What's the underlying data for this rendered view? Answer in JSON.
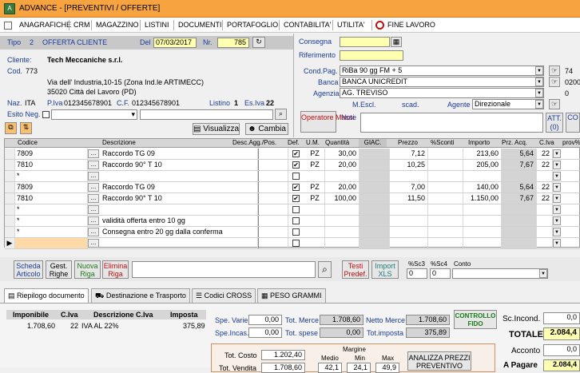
{
  "window": {
    "title": "ADVANCE - [PREVENTIVI / OFFERTE]"
  },
  "menu": [
    "ANAGRAFICHE",
    "CRM",
    "MAGAZZINO",
    "LISTINI",
    "DOCUMENTI",
    "PORTAFOGLIO",
    "CONTABILITA'",
    "UTILITA'",
    "FINE LAVORO"
  ],
  "header": {
    "tipo_label": "Tipo",
    "tipo_num": "2",
    "tipo_desc": "OFFERTA CLIENTE",
    "del_label": "Del",
    "date": "07/03/2017",
    "nr_label": "Nr.",
    "number": "785"
  },
  "client": {
    "cliente_label": "Cliente:",
    "name": "Tech Meccaniche s.r.l.",
    "cod_label": "Cod.",
    "cod": "773",
    "address1": "Via dell' Industria,10-15 (Zona Ind.le ARTIMECC)",
    "address2": "35020 Città del Lavoro (PD)",
    "naz_label": "Naz.",
    "naz": "ITA",
    "piva_label": "P.Iva",
    "piva": "012345678901",
    "cf_label": "C.F.",
    "cf": "012345678901",
    "listino_label": "Listino",
    "listino": "1",
    "esiva_label": "Es.Iva",
    "esiva": "22",
    "esito_label": "Esito Neg.",
    "visualizza": "Visualizza",
    "cambia": "Cambia"
  },
  "right": {
    "consegna_label": "Consegna",
    "riferimento_label": "Riferimento",
    "condpag_label": "Cond.Pag.",
    "condpag": "RiBa 90 gg FM + 5",
    "condpag_code": "74",
    "banca_label": "Banca",
    "banca": "BANCA UNICREDIT",
    "banca_code": "0200",
    "agenzia_label": "Agenzia",
    "agenzia": "AG. TREVISO",
    "agenzia_code": "0",
    "mescl_label": "M.Escl.",
    "scad_label": "scad.",
    "agente_label": "Agente",
    "agente": "Direzionale",
    "operatore": "Operatore Massi",
    "note_label": "Note",
    "att": "ATT. (0)",
    "co": "CO"
  },
  "grid": {
    "columns": [
      "Codice",
      "Descrizione",
      "Desc.Agg./Pos.",
      "Def.",
      "U.M.",
      "Quantità",
      "GIAC.",
      "Prezzo",
      "%Sconti",
      "Importo",
      "Prz. Acq.",
      "C.Iva",
      "prov%"
    ],
    "rows": [
      {
        "codice": "7809",
        "desc": "Raccordo TG 09",
        "def": true,
        "um": "PZ",
        "qta": "30,00",
        "prezzo": "7,12",
        "importo": "213,60",
        "acq": "5,64",
        "iva": "22"
      },
      {
        "codice": "7810",
        "desc": "Raccordo 90° T 10",
        "def": true,
        "um": "PZ",
        "qta": "20,00",
        "prezzo": "10,25",
        "importo": "205,00",
        "acq": "7,67",
        "iva": "22"
      },
      {
        "codice": "*",
        "desc": "",
        "def": false,
        "um": "",
        "qta": "",
        "prezzo": "",
        "importo": "",
        "acq": "",
        "iva": ""
      },
      {
        "codice": "7809",
        "desc": "Raccordo TG 09",
        "def": true,
        "um": "PZ",
        "qta": "20,00",
        "prezzo": "7,00",
        "importo": "140,00",
        "acq": "5,64",
        "iva": "22"
      },
      {
        "codice": "7810",
        "desc": "Raccordo 90° T 10",
        "def": true,
        "um": "PZ",
        "qta": "100,00",
        "prezzo": "11,50",
        "importo": "1.150,00",
        "acq": "7,67",
        "iva": "22"
      },
      {
        "codice": "*",
        "desc": "",
        "def": false,
        "um": "",
        "qta": "",
        "prezzo": "",
        "importo": "",
        "acq": "",
        "iva": ""
      },
      {
        "codice": "*",
        "desc": "validità offerta entro 10 gg",
        "def": false,
        "um": "",
        "qta": "",
        "prezzo": "",
        "importo": "",
        "acq": "",
        "iva": ""
      },
      {
        "codice": "*",
        "desc": "Consegna entro 20 gg dalla conferma",
        "def": false,
        "um": "",
        "qta": "",
        "prezzo": "",
        "importo": "",
        "acq": "",
        "iva": ""
      },
      {
        "codice": "",
        "desc": "",
        "def": false,
        "um": "",
        "qta": "",
        "prezzo": "",
        "importo": "",
        "acq": "",
        "iva": ""
      }
    ]
  },
  "toolbar2": {
    "scheda": "Scheda Articolo",
    "gest": "Gest. Righe",
    "nuova": "Nuova Riga",
    "elimina": "Elimina Riga",
    "testi": "Testi Predef.",
    "import": "Import XLS",
    "sc3_label": "%Sc3",
    "sc3": "0",
    "sc4_label": "%Sc4",
    "sc4": "0",
    "conto_label": "Conto"
  },
  "tabs": [
    "Riepilogo documento",
    "Destinazione e Trasporto",
    "Codici CROSS",
    "PESO GRAMMI"
  ],
  "riepilogo": {
    "headers": [
      "Imponibile",
      "C.Iva",
      "Descrizione C.Iva",
      "Imposta"
    ],
    "row": [
      "1.708,60",
      "22",
      "IVA AL 22%",
      "375,89"
    ]
  },
  "totals": {
    "spe_varie_label": "Spe. Varie",
    "spe_varie": "0,00",
    "tot_merce_label": "Tot. Merce",
    "tot_merce": "1.708,60",
    "netto_merce_label": "Netto Merce",
    "netto_merce": "1.708,60",
    "spe_incas_label": "Spe.Incas.",
    "spe_incas": "0,00",
    "tot_spese_label": "Tot. spese",
    "tot_spese": "0,00",
    "tot_imposta_label": "Tot.imposta",
    "tot_imposta": "375,89",
    "controllo_fido": "CONTROLLO FIDO",
    "sc_incond_label": "Sc.Incond.",
    "sc_incond": "0,0",
    "totale_label": "TOTALE",
    "totale": "2.084,4",
    "acconto_label": "Acconto",
    "acconto": "0,0",
    "apagare_label": "A Pagare",
    "apagare": "2.084,4"
  },
  "margini": {
    "tot_costo_label": "Tot. Costo",
    "tot_costo": "1.202,40",
    "tot_vendita_label": "Tot. Vendita",
    "tot_vendita": "1.708,60",
    "margine_label": "Margine",
    "medio_label": "Medio",
    "min_label": "Min",
    "max_label": "Max",
    "medio": "42,1",
    "min": "24,1",
    "max": "49,9",
    "analizza": "ANALIZZA PREZZI PREVENTIVO"
  }
}
